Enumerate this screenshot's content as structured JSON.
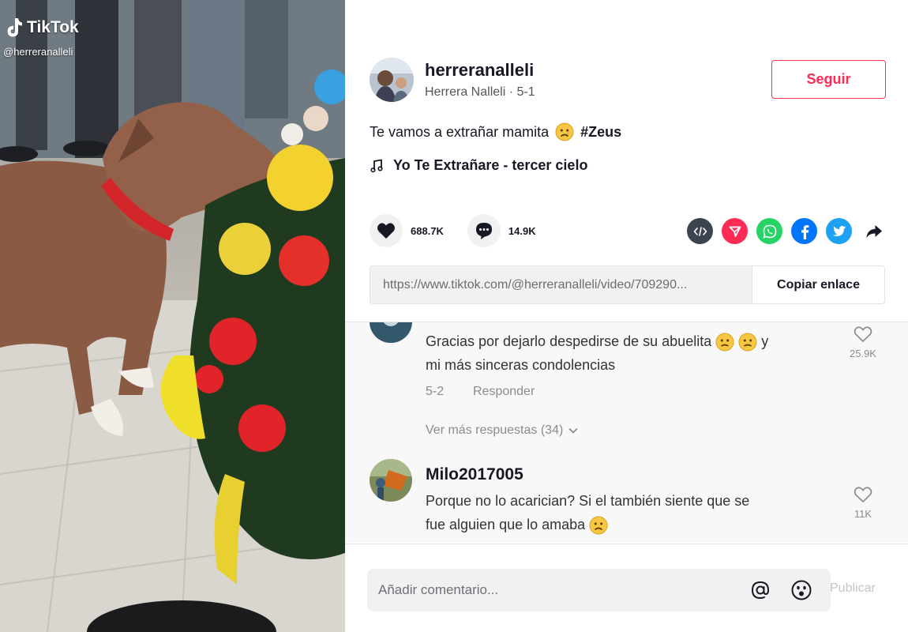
{
  "video": {
    "brand": "TikTok",
    "handle": "@herreranalleli"
  },
  "author": {
    "username": "herreranalleli",
    "nickname": "Herrera Nalleli",
    "date": "5-1",
    "follow_label": "Seguir"
  },
  "post": {
    "caption": "Te vamos a extrañar mamita",
    "hashtag": "#Zeus",
    "music": "Yo Te Extrañare - tercer cielo"
  },
  "stats": {
    "likes": "688.7K",
    "comments": "14.9K"
  },
  "share": {
    "icons": [
      "embed-icon",
      "send-icon",
      "whatsapp-icon",
      "facebook-icon",
      "twitter-icon",
      "share-arrow-icon"
    ],
    "colors": {
      "embed": "#3d4451",
      "send": "#fe2c55",
      "whatsapp": "#25d366",
      "facebook": "#0075fa",
      "twitter": "#1da1f2"
    }
  },
  "link": {
    "url": "https://www.tiktok.com/@herreranalleli/video/709290...",
    "copy_label": "Copiar enlace"
  },
  "comments": [
    {
      "text_line1": "Gracias por dejarlo despedirse de su abuelita",
      "text_after": "y",
      "text_line2": "mi más sinceras condolencias",
      "date": "5-2",
      "reply_label": "Responder",
      "likes": "25.9K",
      "more_replies": "Ver más respuestas (34)"
    },
    {
      "username": "Milo2017005",
      "text_line1": "Porque no lo acarician? Si el también siente que se",
      "text_line2": "fue alguien que lo amaba",
      "likes": "11K"
    }
  ],
  "composer": {
    "placeholder": "Añadir comentario...",
    "post_label": "Publicar"
  },
  "colors": {
    "accent": "#fe2c55",
    "text": "#161823",
    "muted": "#8a8b91"
  }
}
